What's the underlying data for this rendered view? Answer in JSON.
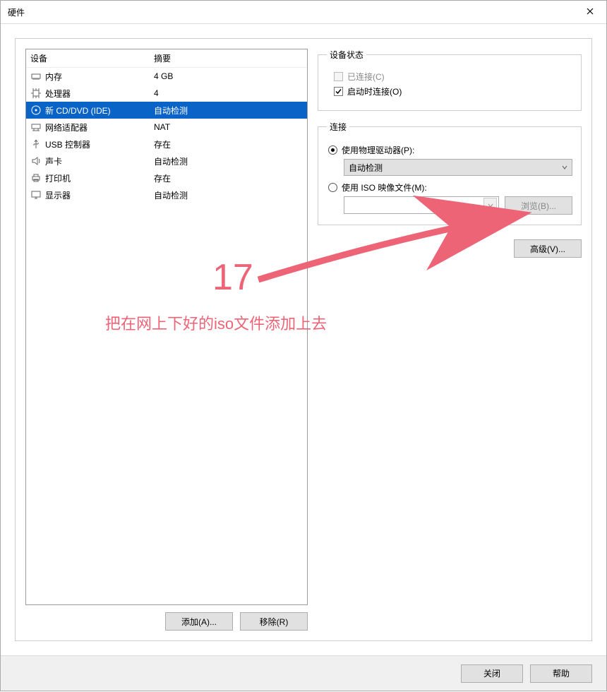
{
  "title": "硬件",
  "headers": {
    "device": "设备",
    "summary": "摘要"
  },
  "devices": [
    {
      "name": "内存",
      "summary": "4 GB",
      "icon": "memory-icon"
    },
    {
      "name": "处理器",
      "summary": "4",
      "icon": "cpu-icon"
    },
    {
      "name": "新 CD/DVD (IDE)",
      "summary": "自动检测",
      "icon": "disc-icon",
      "selected": true
    },
    {
      "name": "网络适配器",
      "summary": "NAT",
      "icon": "network-icon"
    },
    {
      "name": "USB 控制器",
      "summary": "存在",
      "icon": "usb-icon"
    },
    {
      "name": "声卡",
      "summary": "自动检测",
      "icon": "sound-icon"
    },
    {
      "name": "打印机",
      "summary": "存在",
      "icon": "printer-icon"
    },
    {
      "name": "显示器",
      "summary": "自动检测",
      "icon": "display-icon"
    }
  ],
  "left_buttons": {
    "add": "添加(A)...",
    "remove": "移除(R)"
  },
  "status_group": {
    "legend": "设备状态",
    "connected": "已连接(C)",
    "connect_on_poweron": "启动时连接(O)"
  },
  "connection_group": {
    "legend": "连接",
    "use_physical": "使用物理驱动器(P):",
    "physical_value": "自动检测",
    "use_iso": "使用 ISO 映像文件(M):",
    "browse": "浏览(B)..."
  },
  "advanced": "高级(V)...",
  "footer": {
    "close": "关闭",
    "help": "帮助"
  },
  "annotation": {
    "number": "17",
    "text": "把在网上下好的iso文件添加上去"
  }
}
